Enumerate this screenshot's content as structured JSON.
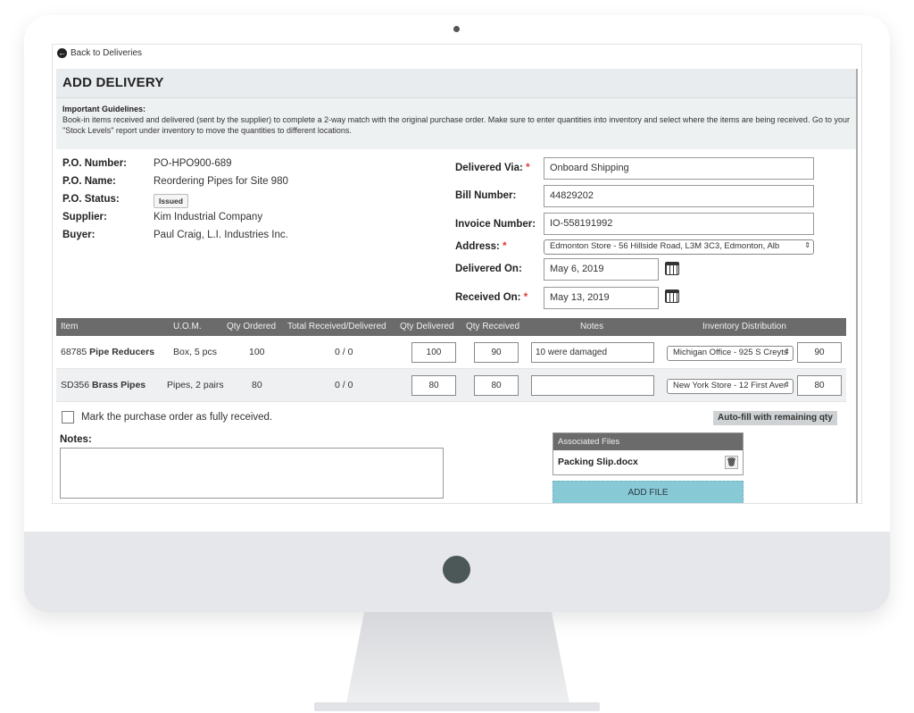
{
  "nav": {
    "back_label": "Back to Deliveries"
  },
  "page": {
    "title": "ADD DELIVERY"
  },
  "guidelines": {
    "heading": "Important Guidelines:",
    "text": "Book-in items received and delivered (sent by the supplier) to complete a 2-way match with the original purchase order. Make sure to enter quantities into inventory and select where the items are being received. Go to your \"Stock Levels\" report under inventory to move the quantities to different locations."
  },
  "po": {
    "number_label": "P.O. Number:",
    "number": "PO-HPO900-689",
    "name_label": "P.O. Name:",
    "name": "Reordering Pipes for Site 980",
    "status_label": "P.O. Status:",
    "status": "Issued",
    "supplier_label": "Supplier:",
    "supplier": "Kim Industrial Company",
    "buyer_label": "Buyer:",
    "buyer": "Paul Craig, L.I. Industries Inc."
  },
  "delivery": {
    "via_label": "Delivered Via:",
    "via": "Onboard Shipping",
    "bill_label": "Bill Number:",
    "bill": "44829202",
    "invoice_label": "Invoice Number:",
    "invoice": "IO-558191992",
    "address_label": "Address:",
    "address": "Edmonton Store - 56 Hillside Road, L3M 3C3, Edmonton, Alb",
    "delivered_on_label": "Delivered On:",
    "delivered_on": "May 6, 2019",
    "received_on_label": "Received On:",
    "received_on": "May 13, 2019",
    "required_mark": "*"
  },
  "items_table": {
    "headers": [
      "Item",
      "U.O.M.",
      "Qty Ordered",
      "Total Received/Delivered",
      "Qty Delivered",
      "Qty Received",
      "Notes",
      "Inventory Distribution"
    ],
    "rows": [
      {
        "code": "68785",
        "name": "Pipe Reducers",
        "uom": "Box, 5 pcs",
        "ordered": "100",
        "total": "0 / 0",
        "delivered": "100",
        "received": "90",
        "notes": "10 were damaged",
        "location": "Michigan Office - 925 S Creyts",
        "dist_qty": "90"
      },
      {
        "code": "SD356",
        "name": "Brass Pipes",
        "uom": "Pipes, 2 pairs",
        "ordered": "80",
        "total": "0 / 0",
        "delivered": "80",
        "received": "80",
        "notes": "",
        "location": "New York Store - 12 First Aver",
        "dist_qty": "80"
      }
    ]
  },
  "mark_received_label": "Mark the purchase order as fully received.",
  "autofill_label": "Auto-fill with remaining qty",
  "notes": {
    "label": "Notes:"
  },
  "files": {
    "header": "Associated Files",
    "items": [
      "Packing Slip.docx"
    ],
    "add_label": "ADD FILE"
  },
  "colors": {
    "table_header": "#6b6b6b",
    "add_file_button": "#88c9d6",
    "required": "#e53935",
    "panel_header": "#e8ecee"
  },
  "icons": [
    "back-arrow-icon",
    "calendar-icon",
    "trash-icon",
    "chevron-updown-icon",
    "power-button"
  ]
}
